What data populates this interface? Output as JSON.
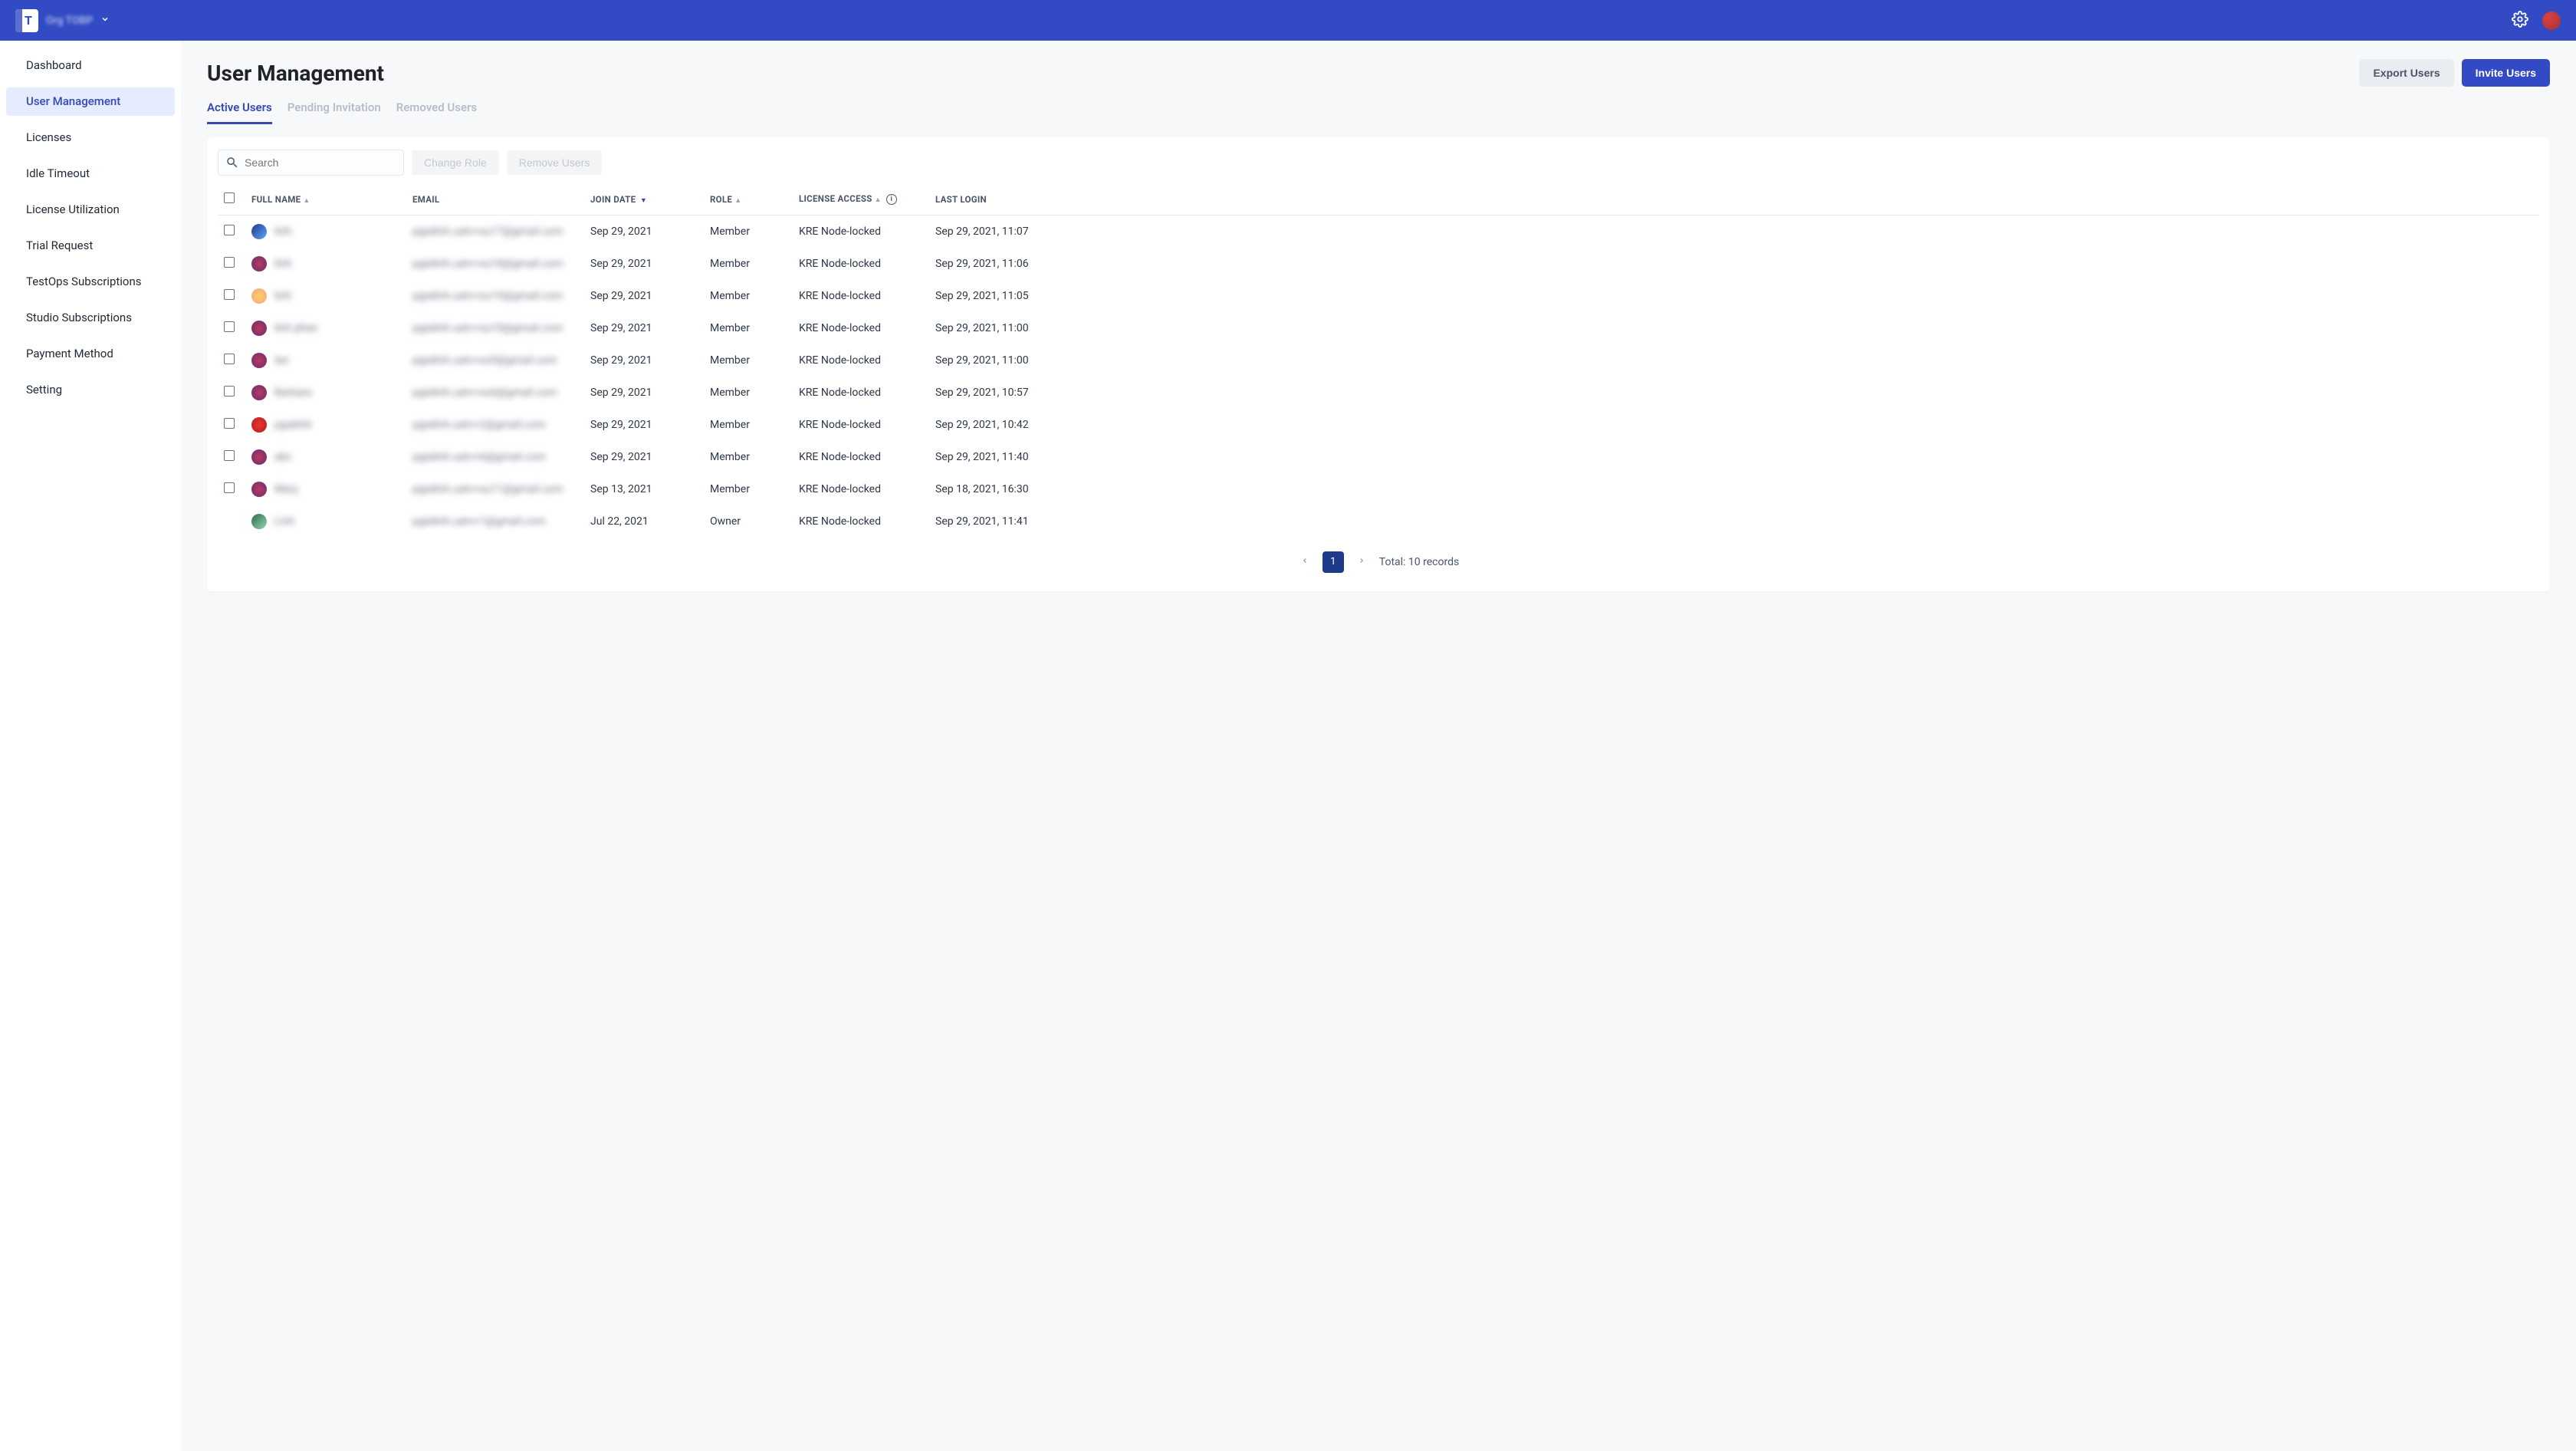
{
  "topbar": {
    "org_label": "Org TOBP"
  },
  "sidebar": {
    "items": [
      {
        "label": "Dashboard"
      },
      {
        "label": "User Management"
      },
      {
        "label": "Licenses"
      },
      {
        "label": "Idle Timeout"
      },
      {
        "label": "License Utilization"
      },
      {
        "label": "Trial Request"
      },
      {
        "label": "TestOps Subscriptions"
      },
      {
        "label": "Studio Subscriptions"
      },
      {
        "label": "Payment Method"
      },
      {
        "label": "Setting"
      }
    ]
  },
  "page": {
    "title": "User Management",
    "export_btn": "Export Users",
    "invite_btn": "Invite Users"
  },
  "tabs": [
    {
      "label": "Active Users",
      "active": true
    },
    {
      "label": "Pending Invitation",
      "active": false
    },
    {
      "label": "Removed Users",
      "active": false
    }
  ],
  "toolbar": {
    "search_placeholder": "Search",
    "change_role": "Change Role",
    "remove_users": "Remove Users"
  },
  "columns": {
    "full_name": "FULL NAME",
    "email": "EMAIL",
    "join_date": "JOIN DATE",
    "role": "ROLE",
    "license_access": "LICENSE ACCESS",
    "last_login": "LAST LOGIN"
  },
  "rows": [
    {
      "name": "linh",
      "email": "pgialinh.uatv+su17@gmail.com",
      "join": "Sep 29, 2021",
      "role": "Member",
      "lic": "KRE Node-locked",
      "last": "Sep 29, 2021, 11:07",
      "av": "av1",
      "chk": true
    },
    {
      "name": "linh",
      "email": "pgialinh.uatv+su18@gmail.com",
      "join": "Sep 29, 2021",
      "role": "Member",
      "lic": "KRE Node-locked",
      "last": "Sep 29, 2021, 11:06",
      "av": "av2",
      "chk": true
    },
    {
      "name": "linh",
      "email": "pgialinh.uatv+su19@gmail.com",
      "join": "Sep 29, 2021",
      "role": "Member",
      "lic": "KRE Node-locked",
      "last": "Sep 29, 2021, 11:05",
      "av": "av3",
      "chk": true
    },
    {
      "name": "linh phan",
      "email": "pgialinh.uatv+su10@gmail.com",
      "join": "Sep 29, 2021",
      "role": "Member",
      "lic": "KRE Node-locked",
      "last": "Sep 29, 2021, 11:00",
      "av": "av2",
      "chk": true
    },
    {
      "name": "lan",
      "email": "pgialinh.uatv+su9@gmail.com",
      "join": "Sep 29, 2021",
      "role": "Member",
      "lic": "KRE Node-locked",
      "last": "Sep 29, 2021, 11:00",
      "av": "av2",
      "chk": true
    },
    {
      "name": "Barbara",
      "email": "pgialinh.uatv+su6@gmail.com",
      "join": "Sep 29, 2021",
      "role": "Member",
      "lic": "KRE Node-locked",
      "last": "Sep 29, 2021, 10:57",
      "av": "av2",
      "chk": true
    },
    {
      "name": "pgialinh",
      "email": "pgialinh.uatv+2@gmail.com",
      "join": "Sep 29, 2021",
      "role": "Member",
      "lic": "KRE Node-locked",
      "last": "Sep 29, 2021, 10:42",
      "av": "av4",
      "chk": true
    },
    {
      "name": "abc",
      "email": "pgialinh.uatv+6@gmail.com",
      "join": "Sep 29, 2021",
      "role": "Member",
      "lic": "KRE Node-locked",
      "last": "Sep 29, 2021, 11:40",
      "av": "av2",
      "chk": true
    },
    {
      "name": "Mary",
      "email": "pgialinh.uatv+su11@gmail.com",
      "join": "Sep 13, 2021",
      "role": "Member",
      "lic": "KRE Node-locked",
      "last": "Sep 18, 2021, 16:30",
      "av": "av2",
      "chk": true
    },
    {
      "name": "Linh",
      "email": "pgialinh.uatv+1@gmail.com",
      "join": "Jul 22, 2021",
      "role": "Owner",
      "lic": "KRE Node-locked",
      "last": "Sep 29, 2021, 11:41",
      "av": "av5",
      "chk": false
    }
  ],
  "pagination": {
    "current": "1",
    "total_label": "Total: 10 records"
  }
}
